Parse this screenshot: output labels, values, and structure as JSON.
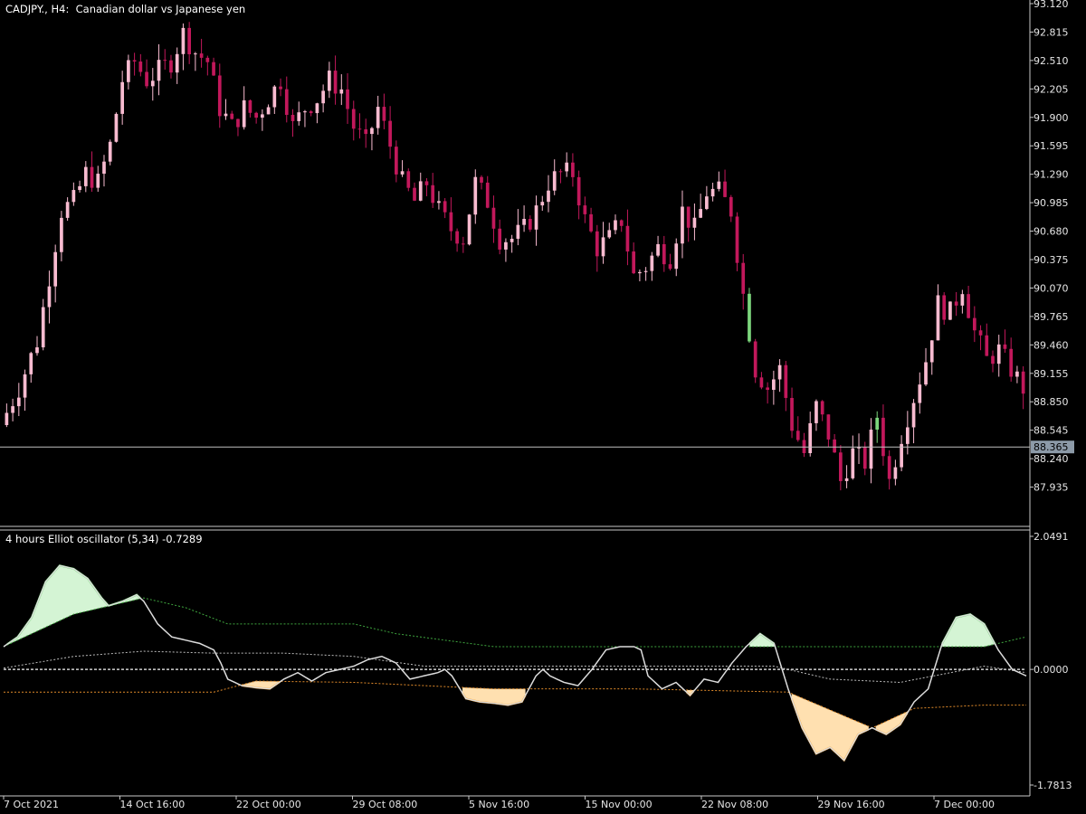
{
  "header": {
    "symbol_label": "CADJPY., H4:  Canadian dollar vs Japanese yen",
    "indicator_label": "4 hours Elliot oscillator (5,34) -0.7289"
  },
  "colors": {
    "background": "#000000",
    "axis": "#c8c8c8",
    "candle_down": "#c2185b",
    "candle_up": "#f8bbd0",
    "candle_up_alt": "#7cd67c",
    "price_line": "#c0c0c0",
    "price_tag_bg": "#8c9aa8",
    "osc_line": "#dcdcdc",
    "fill_pos": "#d4f4d4",
    "edge_pos": "#5cd65c",
    "fill_neg": "#ffe0b0",
    "edge_neg": "#ff9f1c",
    "upper_band": "#3fa63f",
    "lower_band": "#e08a2a",
    "mid_dashed": "#cfcfcf",
    "signal_dashed": "#bbbbbb"
  },
  "chart_data": [
    {
      "type": "candlestick",
      "title": "CADJPY., H4:  Canadian dollar vs Japanese yen",
      "ylim": [
        87.63,
        93.12
      ],
      "y_ticks": [
        "93.120",
        "92.815",
        "92.510",
        "92.205",
        "91.900",
        "91.595",
        "91.290",
        "90.985",
        "90.680",
        "90.375",
        "90.070",
        "89.765",
        "89.460",
        "89.155",
        "88.850",
        "88.545",
        "88.240",
        "87.935"
      ],
      "current_price": "88.365",
      "x_ticks": [
        "7 Oct 2021",
        "14 Oct 16:00",
        "22 Oct 00:00",
        "29 Oct 08:00",
        "5 Nov 16:00",
        "15 Nov 00:00",
        "22 Nov 08:00",
        "29 Nov 16:00",
        "7 Dec 00:00"
      ],
      "close_path": [
        [
          0,
          88.6
        ],
        [
          3,
          89.0
        ],
        [
          6,
          89.5
        ],
        [
          8,
          90.2
        ],
        [
          10,
          90.9
        ],
        [
          12,
          91.0
        ],
        [
          14,
          91.3
        ],
        [
          16,
          91.2
        ],
        [
          18,
          91.6
        ],
        [
          20,
          92.3
        ],
        [
          22,
          92.5
        ],
        [
          24,
          92.3
        ],
        [
          26,
          92.4
        ],
        [
          28,
          92.5
        ],
        [
          30,
          92.8
        ],
        [
          32,
          92.6
        ],
        [
          34,
          92.5
        ],
        [
          36,
          92.0
        ],
        [
          38,
          91.8
        ],
        [
          40,
          92.0
        ],
        [
          42,
          91.9
        ],
        [
          44,
          92.1
        ],
        [
          46,
          92.3
        ],
        [
          48,
          91.8
        ],
        [
          50,
          92.0
        ],
        [
          52,
          92.1
        ],
        [
          54,
          92.3
        ],
        [
          56,
          92.2
        ],
        [
          58,
          91.8
        ],
        [
          60,
          91.6
        ],
        [
          62,
          92.0
        ],
        [
          64,
          91.6
        ],
        [
          66,
          91.2
        ],
        [
          68,
          91.0
        ],
        [
          70,
          91.2
        ],
        [
          72,
          90.9
        ],
        [
          74,
          90.7
        ],
        [
          76,
          90.6
        ],
        [
          78,
          91.2
        ],
        [
          80,
          91.0
        ],
        [
          82,
          90.6
        ],
        [
          84,
          90.6
        ],
        [
          86,
          90.7
        ],
        [
          88,
          90.9
        ],
        [
          90,
          91.2
        ],
        [
          92,
          91.3
        ],
        [
          94,
          91.3
        ],
        [
          96,
          90.8
        ],
        [
          98,
          90.5
        ],
        [
          100,
          90.6
        ],
        [
          102,
          90.8
        ],
        [
          104,
          90.2
        ],
        [
          106,
          90.3
        ],
        [
          108,
          90.5
        ],
        [
          110,
          90.4
        ],
        [
          112,
          90.9
        ],
        [
          114,
          90.7
        ],
        [
          116,
          91.1
        ],
        [
          118,
          91.1
        ],
        [
          120,
          90.9
        ],
        [
          122,
          90.0
        ],
        [
          124,
          89.2
        ],
        [
          126,
          89.0
        ],
        [
          128,
          89.2
        ],
        [
          130,
          88.6
        ],
        [
          132,
          88.3
        ],
        [
          134,
          88.8
        ],
        [
          136,
          88.5
        ],
        [
          138,
          88.0
        ],
        [
          140,
          88.3
        ],
        [
          142,
          88.2
        ],
        [
          144,
          88.7
        ],
        [
          146,
          88.0
        ],
        [
          148,
          88.5
        ],
        [
          150,
          88.9
        ],
        [
          152,
          89.3
        ],
        [
          154,
          89.9
        ],
        [
          156,
          89.8
        ],
        [
          158,
          90.1
        ],
        [
          160,
          89.6
        ],
        [
          162,
          89.3
        ],
        [
          164,
          89.4
        ],
        [
          166,
          89.2
        ],
        [
          168,
          89.0
        ]
      ]
    },
    {
      "type": "line",
      "title": "4 hours Elliot oscillator (5,34) -0.7289",
      "ylim": [
        -1.7813,
        2.0491
      ],
      "y_ticks": [
        "2.0491",
        "0.0000",
        "-1.7813"
      ],
      "oscillator": [
        [
          0,
          0.35
        ],
        [
          2,
          0.5
        ],
        [
          4,
          0.8
        ],
        [
          6,
          1.35
        ],
        [
          8,
          1.6
        ],
        [
          10,
          1.55
        ],
        [
          12,
          1.4
        ],
        [
          14,
          1.1
        ],
        [
          15,
          0.98
        ],
        [
          17,
          1.05
        ],
        [
          19,
          1.15
        ],
        [
          20,
          1.05
        ],
        [
          22,
          0.7
        ],
        [
          24,
          0.5
        ],
        [
          26,
          0.45
        ],
        [
          28,
          0.4
        ],
        [
          30,
          0.3
        ],
        [
          31,
          0.1
        ],
        [
          32,
          -0.15
        ],
        [
          34,
          -0.25
        ],
        [
          36,
          -0.28
        ],
        [
          38,
          -0.3
        ],
        [
          40,
          -0.15
        ],
        [
          42,
          -0.05
        ],
        [
          44,
          -0.18
        ],
        [
          46,
          -0.05
        ],
        [
          48,
          0.0
        ],
        [
          50,
          0.05
        ],
        [
          52,
          0.15
        ],
        [
          54,
          0.2
        ],
        [
          56,
          0.1
        ],
        [
          58,
          -0.15
        ],
        [
          60,
          -0.1
        ],
        [
          62,
          -0.05
        ],
        [
          63,
          0.0
        ],
        [
          64,
          -0.1
        ],
        [
          66,
          -0.45
        ],
        [
          68,
          -0.5
        ],
        [
          70,
          -0.52
        ],
        [
          72,
          -0.55
        ],
        [
          74,
          -0.5
        ],
        [
          76,
          -0.1
        ],
        [
          77,
          0.0
        ],
        [
          78,
          -0.1
        ],
        [
          80,
          -0.2
        ],
        [
          82,
          -0.25
        ],
        [
          84,
          0.0
        ],
        [
          86,
          0.3
        ],
        [
          88,
          0.35
        ],
        [
          90,
          0.35
        ],
        [
          91,
          0.3
        ],
        [
          92,
          -0.1
        ],
        [
          94,
          -0.3
        ],
        [
          96,
          -0.2
        ],
        [
          98,
          -0.4
        ],
        [
          100,
          -0.15
        ],
        [
          102,
          -0.2
        ],
        [
          104,
          0.1
        ],
        [
          106,
          0.35
        ],
        [
          108,
          0.55
        ],
        [
          110,
          0.4
        ],
        [
          112,
          -0.3
        ],
        [
          114,
          -0.9
        ],
        [
          116,
          -1.3
        ],
        [
          118,
          -1.2
        ],
        [
          120,
          -1.4
        ],
        [
          122,
          -1.0
        ],
        [
          124,
          -0.9
        ],
        [
          126,
          -1.0
        ],
        [
          128,
          -0.85
        ],
        [
          130,
          -0.5
        ],
        [
          132,
          -0.3
        ],
        [
          134,
          0.4
        ],
        [
          136,
          0.8
        ],
        [
          138,
          0.85
        ],
        [
          140,
          0.7
        ],
        [
          142,
          0.3
        ],
        [
          144,
          0.0
        ],
        [
          146,
          -0.1
        ]
      ],
      "upper_band": [
        [
          0,
          0.35
        ],
        [
          10,
          0.85
        ],
        [
          20,
          1.1
        ],
        [
          26,
          0.95
        ],
        [
          32,
          0.7
        ],
        [
          50,
          0.7
        ],
        [
          56,
          0.55
        ],
        [
          70,
          0.35
        ],
        [
          110,
          0.35
        ],
        [
          140,
          0.35
        ],
        [
          146,
          0.5
        ]
      ],
      "signal": [
        [
          0,
          0.02
        ],
        [
          10,
          0.2
        ],
        [
          20,
          0.28
        ],
        [
          30,
          0.25
        ],
        [
          40,
          0.25
        ],
        [
          50,
          0.2
        ],
        [
          60,
          0.05
        ],
        [
          80,
          0.05
        ],
        [
          110,
          0.05
        ],
        [
          118,
          -0.15
        ],
        [
          128,
          -0.2
        ],
        [
          140,
          0.05
        ],
        [
          146,
          -0.05
        ]
      ],
      "lower_band": [
        [
          0,
          -0.35
        ],
        [
          30,
          -0.35
        ],
        [
          36,
          -0.18
        ],
        [
          50,
          -0.2
        ],
        [
          70,
          -0.3
        ],
        [
          90,
          -0.3
        ],
        [
          112,
          -0.35
        ],
        [
          124,
          -0.9
        ],
        [
          130,
          -0.6
        ],
        [
          140,
          -0.55
        ],
        [
          146,
          -0.55
        ]
      ]
    }
  ]
}
